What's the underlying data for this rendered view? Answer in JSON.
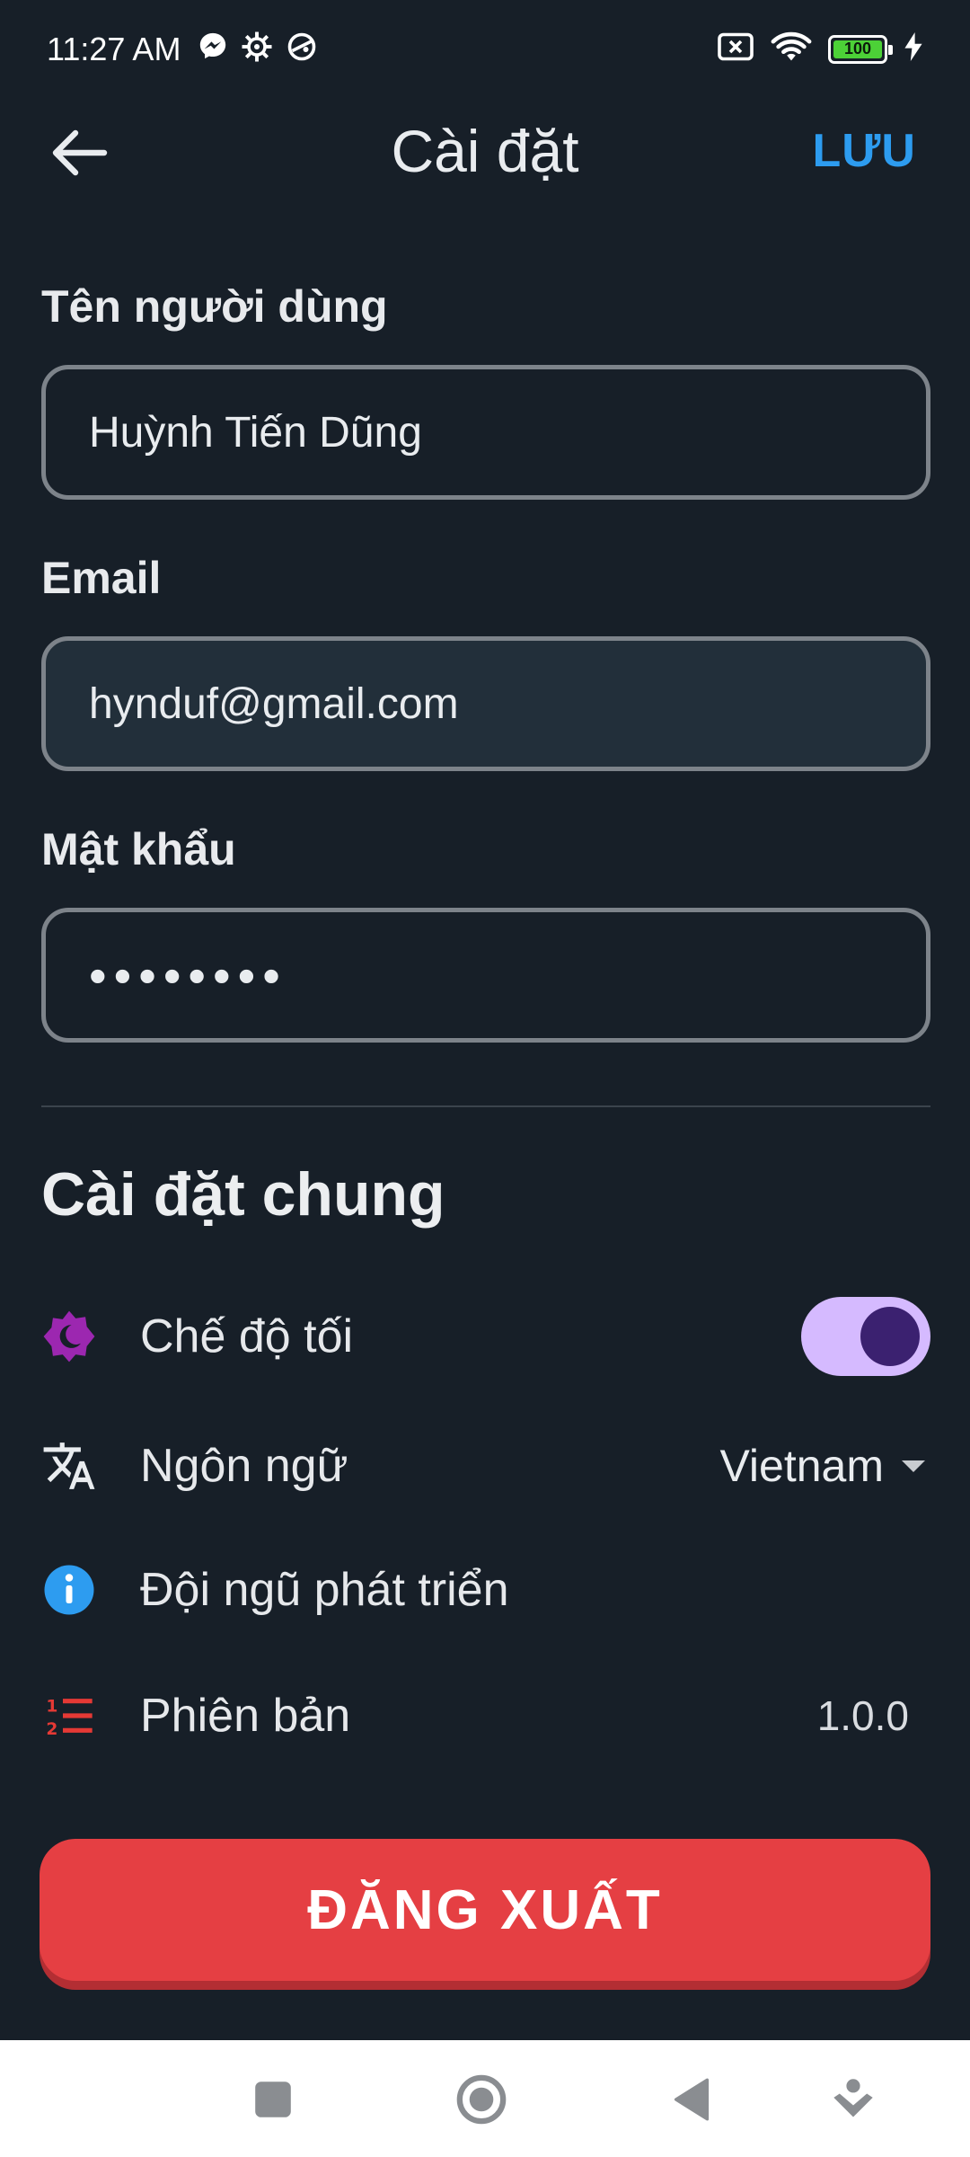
{
  "status_bar": {
    "time": "11:27 AM",
    "battery": "100",
    "icons": [
      "messenger-icon",
      "settings-gear-icon",
      "vpn-icon",
      "no-sim-icon",
      "wifi-icon",
      "battery-icon",
      "charging-icon"
    ]
  },
  "app_bar": {
    "title": "Cài đặt",
    "save_label": "LƯU",
    "back_icon": "arrow-left-icon"
  },
  "form": {
    "username": {
      "label": "Tên người dùng",
      "value": "Huỳnh Tiến Dũng"
    },
    "email": {
      "label": "Email",
      "value": "hynduf@gmail.com"
    },
    "password": {
      "label": "Mật khẩu",
      "value": "••••••••"
    }
  },
  "general": {
    "title": "Cài đặt chung",
    "dark_mode": {
      "label": "Chế độ tối",
      "enabled": true,
      "icon": "dark-mode-icon"
    },
    "language": {
      "label": "Ngôn ngữ",
      "value": "Vietnam",
      "icon": "translate-icon"
    },
    "team": {
      "label": "Đội ngũ phát triển",
      "icon": "info-icon"
    },
    "version": {
      "label": "Phiên bản",
      "value": "1.0.0",
      "icon": "numbered-list-icon"
    }
  },
  "logout_label": "ĐĂNG XUẤT",
  "colors": {
    "background": "#171f28",
    "accent_blue": "#2d9cf0",
    "logout_red": "#e53f43",
    "toggle_track": "#d5baff",
    "toggle_knob": "#3b2170",
    "dark_mode_icon": "#9c27b0",
    "version_icon": "#e53935"
  }
}
